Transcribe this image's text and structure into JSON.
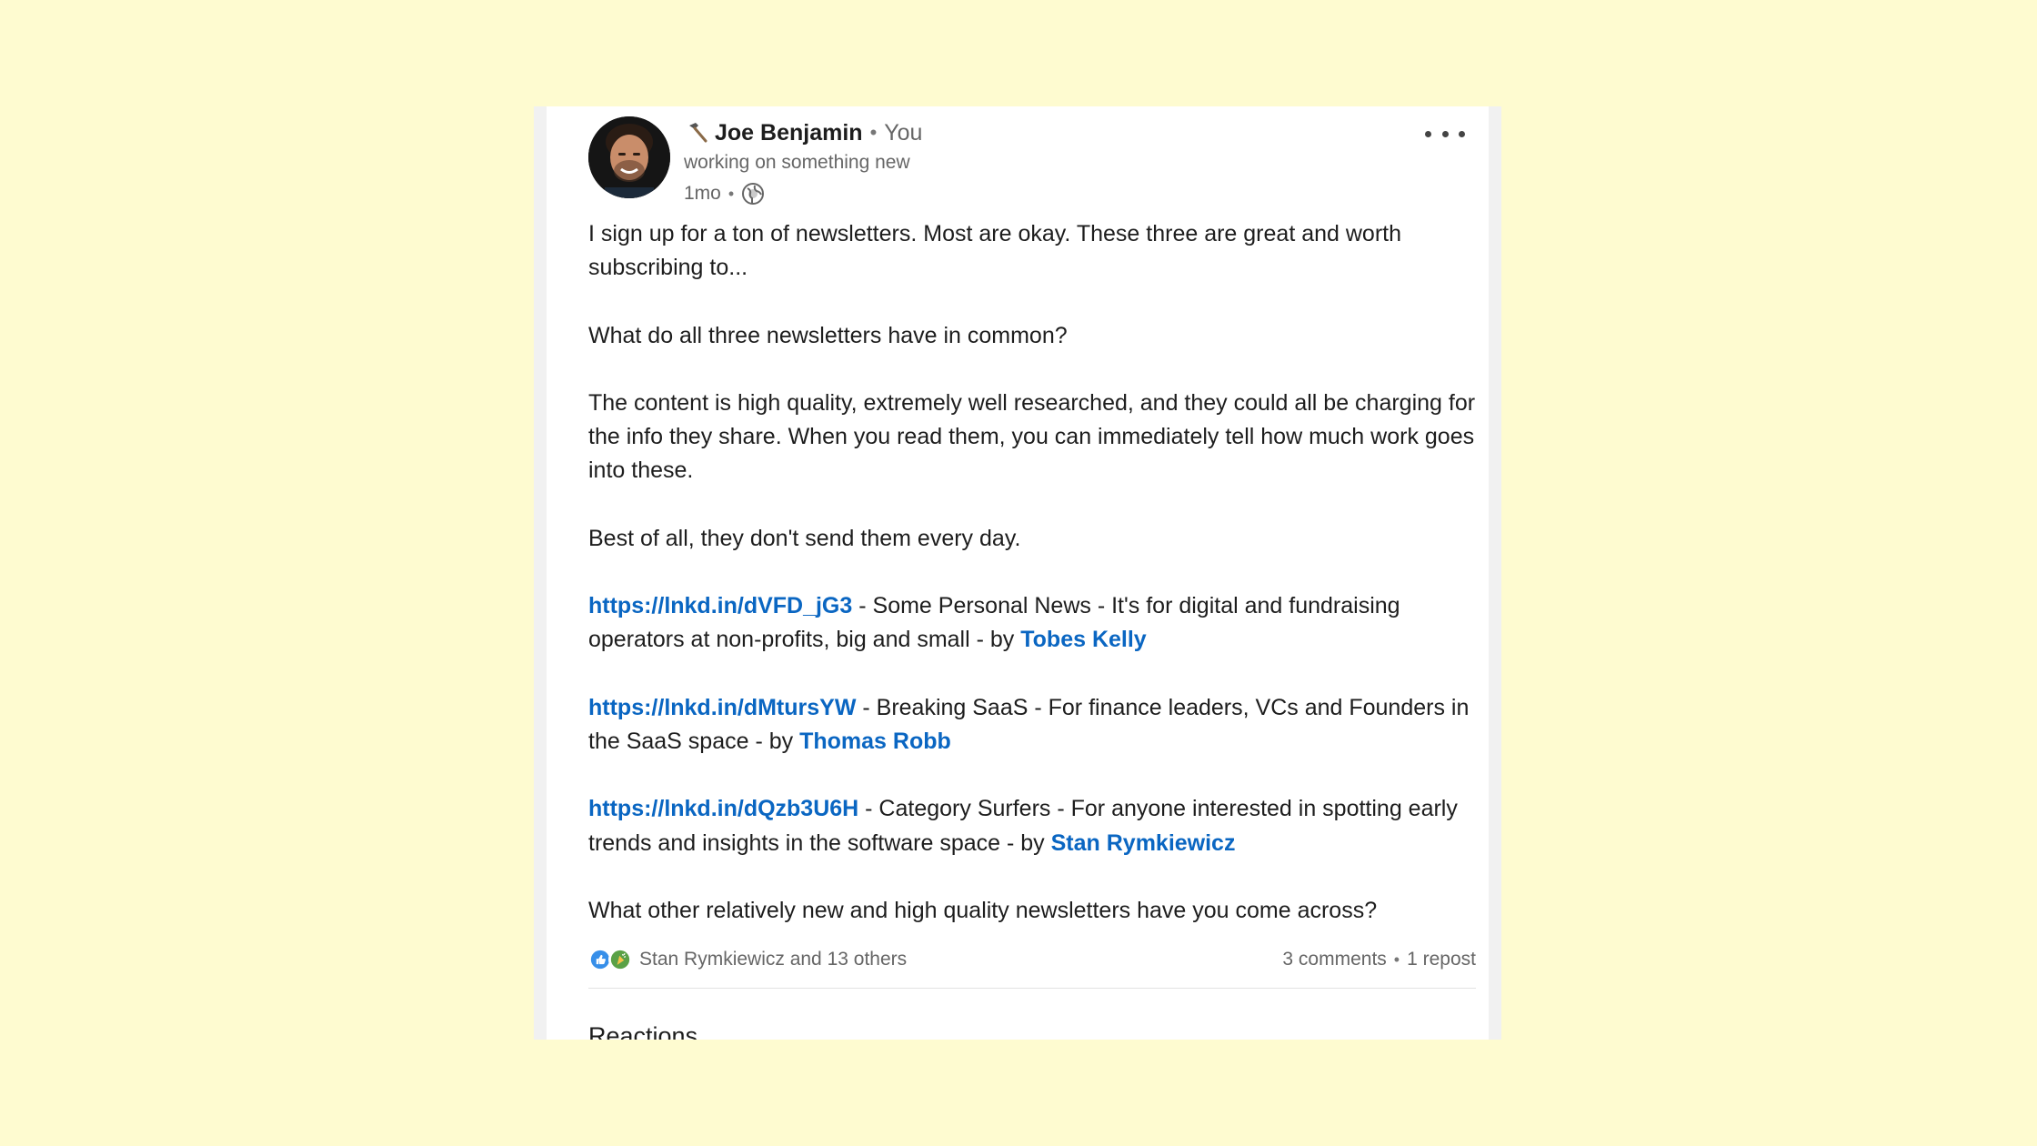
{
  "post": {
    "author": {
      "name": "Joe Benjamin",
      "relation": "You",
      "headline": "working on something new",
      "time": "1mo"
    },
    "body": {
      "p1": "I sign up for a ton of newsletters. Most are okay. These three are great and worth subscribing to...",
      "p2": "What do all three newsletters have in common?",
      "p3": "The content is high quality, extremely well researched, and they could all be charging for the info they share. When you read them, you can immediately tell how much work goes into these.",
      "p4": "Best of all, they don't send them every day.",
      "links": [
        {
          "url": "https://lnkd.in/dVFD_jG3",
          "text": " - Some Personal News - It's for digital and fundraising operators at non-profits, big and small - by ",
          "author": "Tobes Kelly"
        },
        {
          "url": "https://lnkd.in/dMtursYW",
          "text": " - Breaking SaaS - For finance leaders, VCs and Founders in the SaaS space - by ",
          "author": "Thomas Robb"
        },
        {
          "url": "https://lnkd.in/dQzb3U6H",
          "text": " - Category Surfers - For anyone interested in spotting early trends and insights in the software space - by ",
          "author": "Stan Rymkiewicz"
        }
      ],
      "closing": "What other relatively new and high quality newsletters have you come across?"
    },
    "social": {
      "reactions": "Stan Rymkiewicz and 13 others",
      "comments": "3 comments",
      "reposts": "1 repost"
    },
    "reactions_heading": "Reactions"
  },
  "icons": {
    "author_prefix": "hammer-icon",
    "visibility": "globe-icon",
    "more": "more-options-icon",
    "reactions": [
      "like-reaction-icon",
      "celebrate-reaction-icon"
    ]
  },
  "colors": {
    "link": "#0a66c2",
    "background": "#fefbd0"
  }
}
